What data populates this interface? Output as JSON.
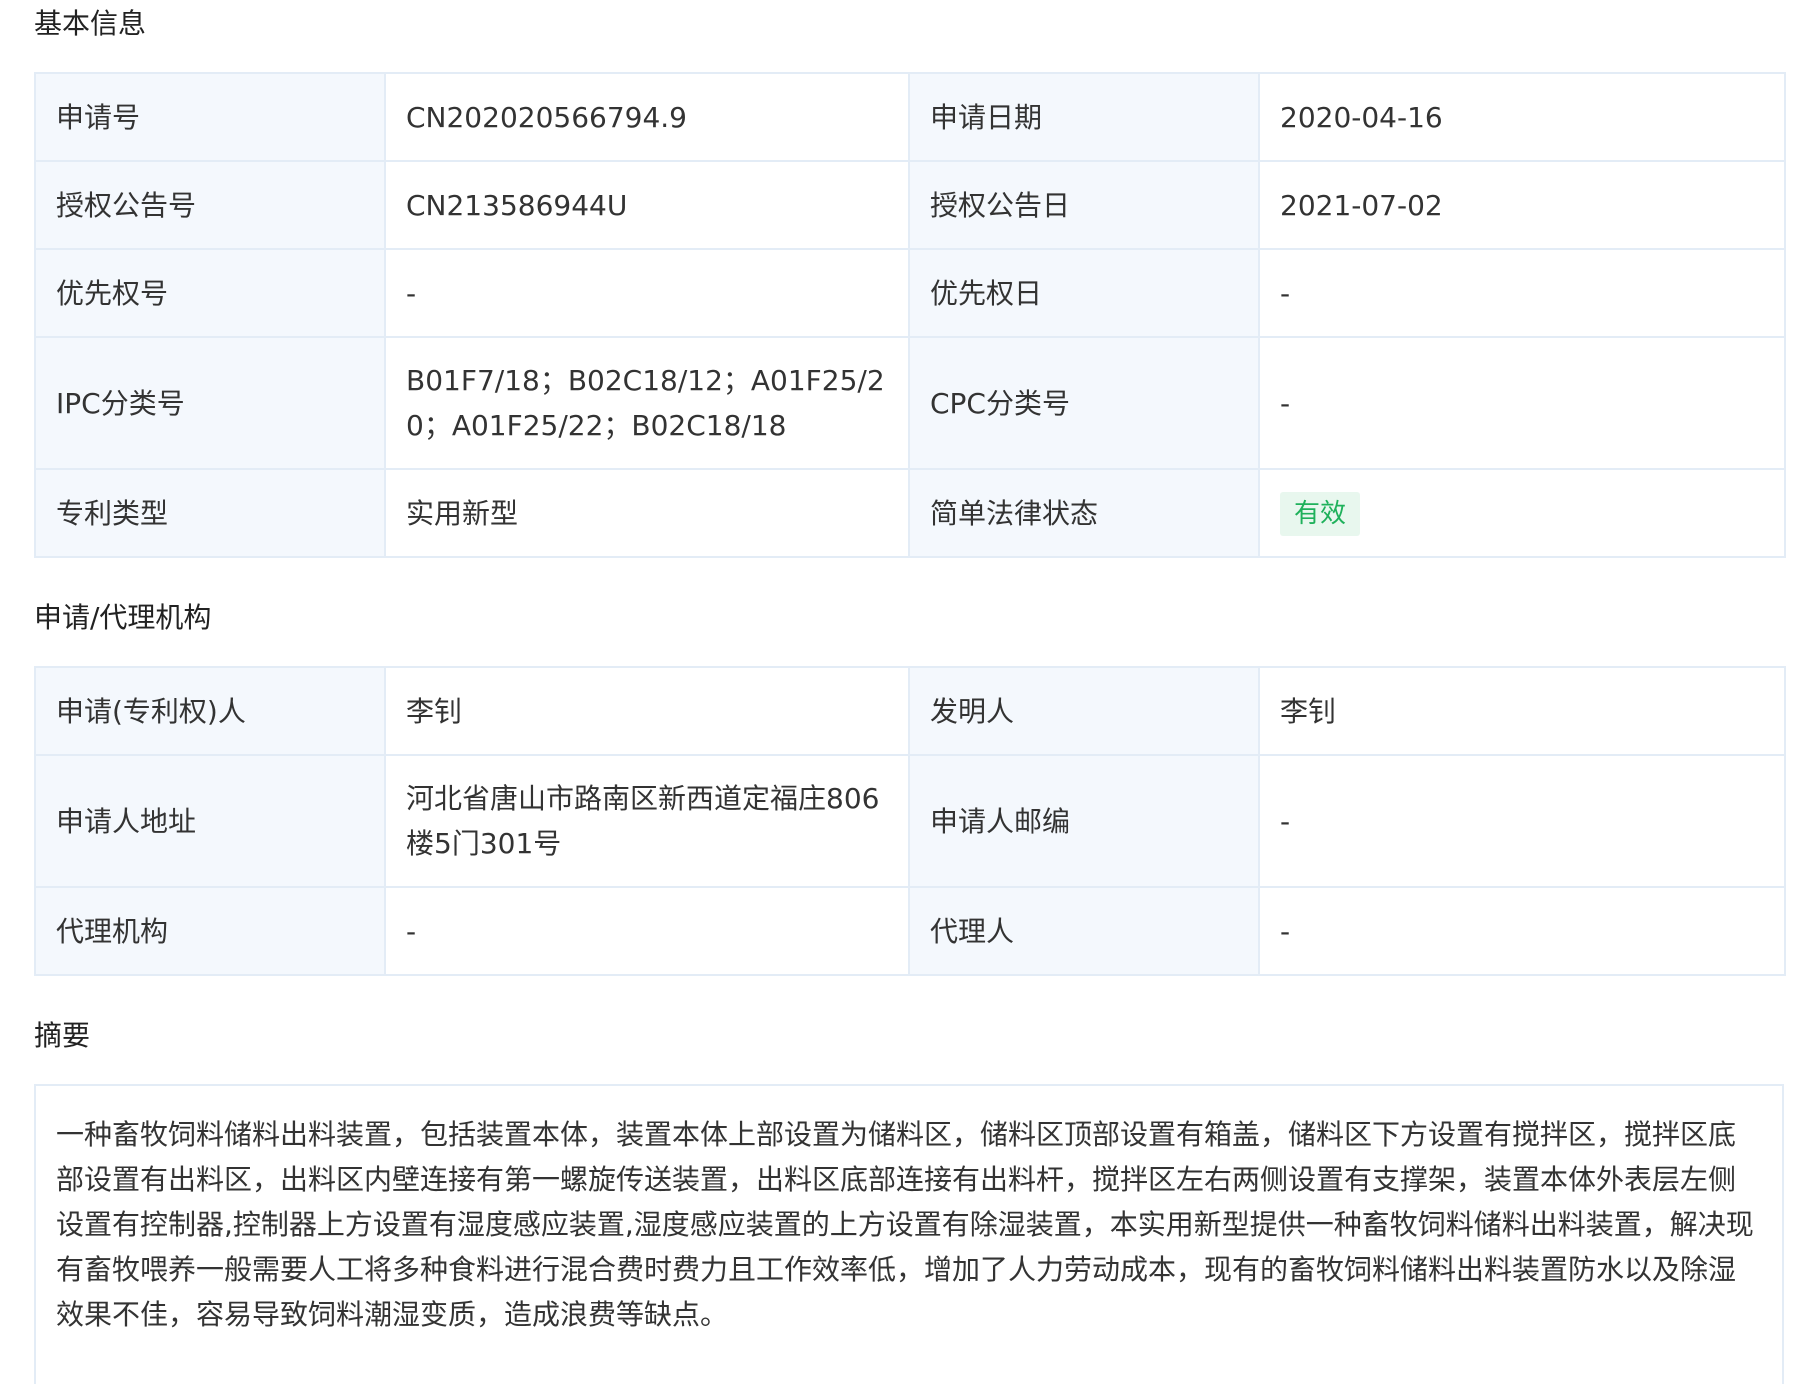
{
  "basic": {
    "title": "基本信息",
    "rows": [
      {
        "k1": "申请号",
        "v1": "CN202020566794.9",
        "k2": "申请日期",
        "v2": "2020-04-16"
      },
      {
        "k1": "授权公告号",
        "v1": "CN213586944U",
        "k2": "授权公告日",
        "v2": "2021-07-02"
      },
      {
        "k1": "优先权号",
        "v1": "-",
        "k2": "优先权日",
        "v2": "-"
      },
      {
        "k1": "IPC分类号",
        "v1": "B01F7/18；B02C18/12；A01F25/20；A01F25/22；B02C18/18",
        "k2": "CPC分类号",
        "v2": "-"
      },
      {
        "k1": "专利类型",
        "v1": "实用新型",
        "k2": "简单法律状态",
        "v2": "有效"
      }
    ],
    "status_color": "#1fb15b"
  },
  "agency": {
    "title": "申请/代理机构",
    "rows": [
      {
        "k1": "申请(专利权)人",
        "v1": "李钊",
        "k2": "发明人",
        "v2": "李钊"
      },
      {
        "k1": "申请人地址",
        "v1": "河北省唐山市路南区新西道定福庄806楼5门301号",
        "k2": "申请人邮编",
        "v2": "-"
      },
      {
        "k1": "代理机构",
        "v1": "-",
        "k2": "代理人",
        "v2": "-"
      }
    ]
  },
  "abstract": {
    "title": "摘要",
    "text": "一种畜牧饲料储料出料装置，包括装置本体，装置本体上部设置为储料区，储料区顶部设置有箱盖，储料区下方设置有搅拌区，搅拌区底部设置有出料区，出料区内壁连接有第一螺旋传送装置，出料区底部连接有出料杆，搅拌区左右两侧设置有支撑架，装置本体外表层左侧设置有控制器,控制器上方设置有湿度感应装置,湿度感应装置的上方设置有除湿装置，本实用新型提供一种畜牧饲料储料出料装置，解决现有畜牧喂养一般需要人工将多种食料进行混合费时费力且工作效率低，增加了人力劳动成本，现有的畜牧饲料储料出料装置防水以及除湿效果不佳，容易导致饲料潮湿变质，造成浪费等缺点。"
  }
}
